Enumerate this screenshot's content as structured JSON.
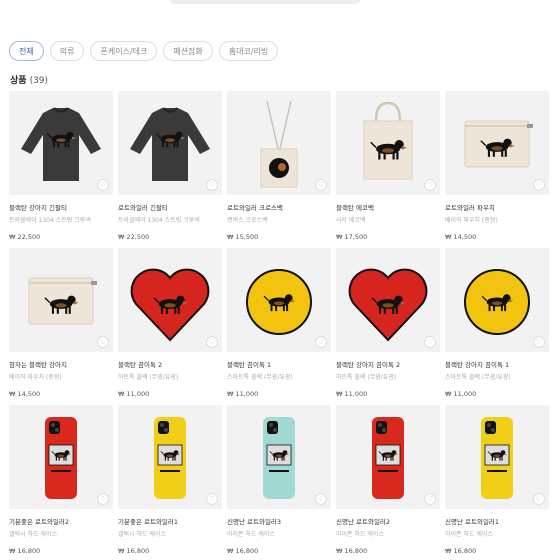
{
  "tabs": [
    "전체",
    "의류",
    "폰케이스/테크",
    "패션잡화",
    "홈데코/리빙"
  ],
  "heading": {
    "label": "상품",
    "count": "(39)"
  },
  "heart_glyph": "♡",
  "products": [
    {
      "name": "블랙탄 강아지 긴팔티",
      "sub": "트라클에이 1304 스트링 크루넥",
      "price": "₩ 22,500",
      "icon": "black-longsleeve-tshirt"
    },
    {
      "name": "로트와일러 긴팔티",
      "sub": "트라클에이 1304 스트링 크루넥",
      "price": "₩ 22,500",
      "icon": "black-longsleeve-tshirt"
    },
    {
      "name": "로트와일러 크로스백",
      "sub": "캔버스 크로스백",
      "price": "₩ 15,500",
      "icon": "cross-bag"
    },
    {
      "name": "블랙탄 에코백",
      "sub": "사각 에코백",
      "price": "₩ 17,500",
      "icon": "eco-bag"
    },
    {
      "name": "로트와일러 파우치",
      "sub": "베이직 파우치 (중형)",
      "price": "₩ 14,500",
      "icon": "pouch"
    },
    {
      "name": "참자는 블랙탄 강아지",
      "sub": "베이직 파우치 (중형)",
      "price": "₩ 14,500",
      "icon": "pouch"
    },
    {
      "name": "블랙탄 끔이톡 2",
      "sub": "하트톡 블랙 (무광/유광)",
      "price": "₩ 11,000",
      "icon": "heart-griptok"
    },
    {
      "name": "블랙탄 끔이톡 1",
      "sub": "스마트톡 블랙 (무광/유광)",
      "price": "₩ 11,000",
      "icon": "round-griptok"
    },
    {
      "name": "블랙탄 강아지 끔이톡 2",
      "sub": "하트톡 블랙 (무광/유광)",
      "price": "₩ 11,000",
      "icon": "heart-griptok"
    },
    {
      "name": "블랙탄 강아지 끔이톡 1",
      "sub": "스마트톡 블랙 (무광/유광)",
      "price": "₩ 11,000",
      "icon": "round-griptok"
    },
    {
      "name": "기분좋은 로트와일러2",
      "sub": "갤럭시 하드 케이스",
      "price": "₩ 16,800",
      "icon": "phone-case-red"
    },
    {
      "name": "기분좋은 로트와일러1",
      "sub": "갤럭시 하드 케이스",
      "price": "₩ 16,800",
      "icon": "phone-case-yellow"
    },
    {
      "name": "신명난 로트와일러3",
      "sub": "아이폰 하드 케이스",
      "price": "₩ 16,800",
      "icon": "phone-case-mint"
    },
    {
      "name": "신명난 로트와일러2",
      "sub": "아이폰 하드 케이스",
      "price": "₩ 16,800",
      "icon": "phone-case-red"
    },
    {
      "name": "신명난 로트와일러1",
      "sub": "아이폰 하드 케이스",
      "price": "₩ 16,800",
      "icon": "phone-case-yellow"
    }
  ],
  "colors": {
    "accent": "#3b5fae",
    "tab_border": "#dddddd",
    "thumb_bg": "#f2f2f2",
    "heart_red": "#d6241f",
    "griptok_yellow": "#f2c40f",
    "case_red": "#d9281d",
    "case_yellow": "#f0cf16",
    "case_mint": "#9fd9d2",
    "shirt": "#3a3a3a",
    "canvas": "#ede6d8"
  }
}
